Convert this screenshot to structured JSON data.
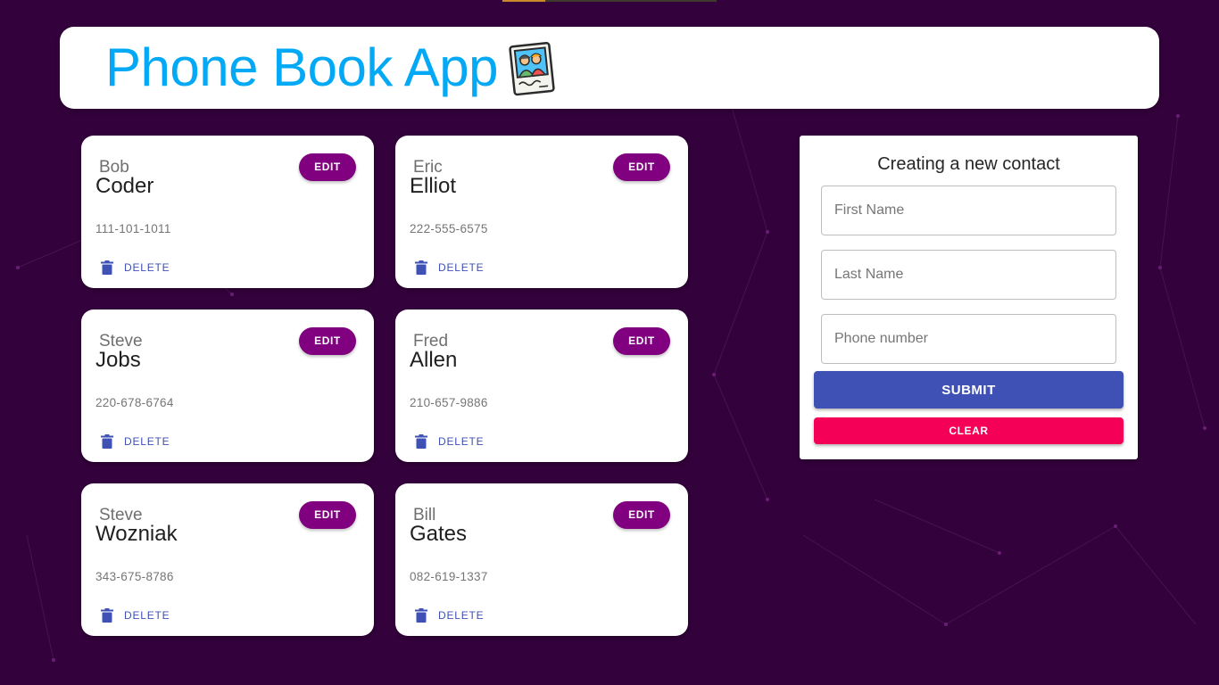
{
  "header": {
    "title": "Phone Book App"
  },
  "contacts": [
    {
      "first": "Bob",
      "last": "Coder",
      "phone": "111-101-1011"
    },
    {
      "first": "Eric",
      "last": "Elliot",
      "phone": "222-555-6575"
    },
    {
      "first": "Steve",
      "last": "Jobs",
      "phone": "220-678-6764"
    },
    {
      "first": "Fred",
      "last": "Allen",
      "phone": "210-657-9886"
    },
    {
      "first": "Steve",
      "last": "Wozniak",
      "phone": "343-675-8786"
    },
    {
      "first": "Bill",
      "last": "Gates",
      "phone": "082-619-1337"
    }
  ],
  "card_actions": {
    "edit_label": "EDIT",
    "delete_label": "DELETE"
  },
  "form": {
    "title": "Creating a new contact",
    "first_name_placeholder": "First Name",
    "last_name_placeholder": "Last Name",
    "phone_placeholder": "Phone number",
    "first_name_value": "",
    "last_name_value": "",
    "phone_value": "",
    "submit_label": "SUBMIT",
    "clear_label": "CLEAR"
  },
  "colors": {
    "background": "#33013b",
    "title": "#03a9f4",
    "edit_button": "#800080",
    "primary": "#3f51b5",
    "secondary": "#f50057"
  }
}
